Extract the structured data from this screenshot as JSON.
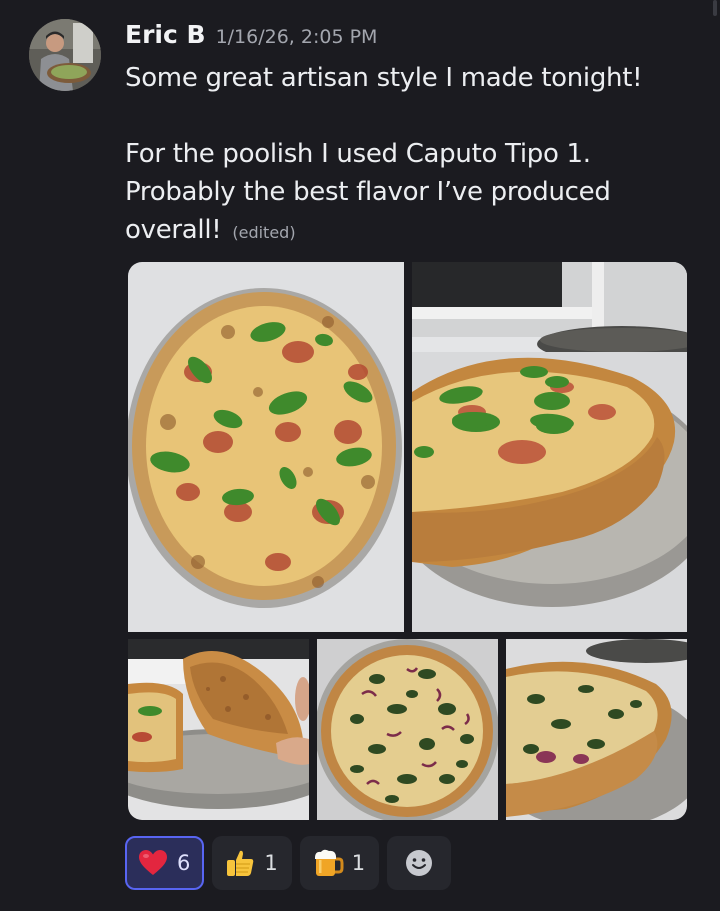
{
  "message": {
    "author": "Eric B",
    "timestamp": "1/16/26, 2:05 PM",
    "lines": {
      "line1": "Some great artisan style I made tonight!",
      "line2": "For the poolish I used Caputo Tipo 1.",
      "line3": "Probably the best flavor I’ve produced",
      "line4": "overall!"
    },
    "edited_label": "(edited)"
  },
  "attachments": [
    {
      "subject": "margherita pizza top view"
    },
    {
      "subject": "margherita pizza angled view"
    },
    {
      "subject": "pizza slice held up"
    },
    {
      "subject": "spinach onion pizza top view"
    },
    {
      "subject": "spinach onion pizza angled view"
    }
  ],
  "reactions": [
    {
      "emoji": "red-heart",
      "count": "6",
      "active": true
    },
    {
      "emoji": "thumbs-up",
      "count": "1",
      "active": false
    },
    {
      "emoji": "beer-mug",
      "count": "1",
      "active": false
    }
  ],
  "colors": {
    "background": "#1b1b20",
    "reaction_active_bg": "#2b2e5a",
    "reaction_active_border": "#5865f2",
    "muted_text": "#a3a6ae"
  }
}
